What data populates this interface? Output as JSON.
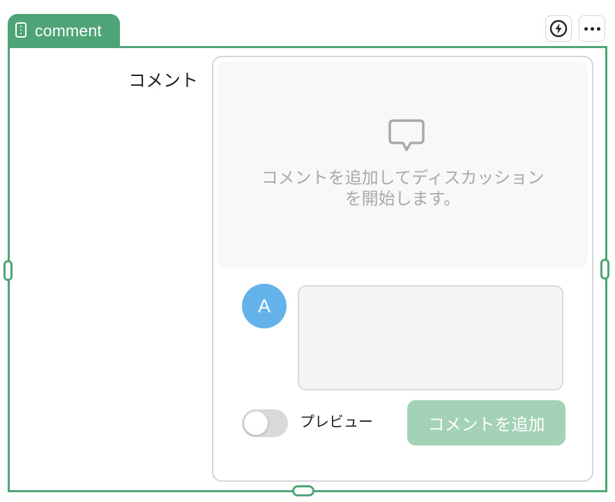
{
  "widget": {
    "type_label": "comment",
    "type_icon": "form-field-icon",
    "actions": [
      {
        "icon": "lightning-icon"
      },
      {
        "icon": "more-dots-icon"
      }
    ],
    "accent_color": "#4ea476"
  },
  "field": {
    "label": "コメント"
  },
  "comments": {
    "empty_icon": "speech-bubble-icon",
    "empty_message_line1": "コメントを追加してディスカッション",
    "empty_message_line2": "を開始します。",
    "avatar_initial": "A",
    "avatar_color": "#63b3ea",
    "input_value": "",
    "preview_label": "プレビュー",
    "preview_enabled": false,
    "submit_label": "コメントを追加",
    "submit_color": "#a3d2b6"
  }
}
